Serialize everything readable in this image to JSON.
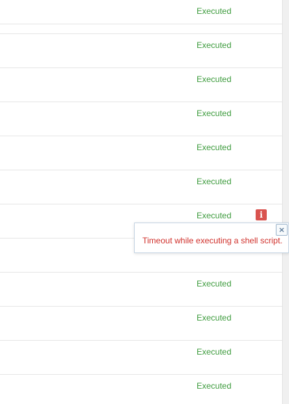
{
  "table": {
    "rows": [
      {
        "status": "Executed",
        "status_color": "#3d9b3d"
      },
      {
        "status": "Executed",
        "status_color": "#3d9b3d"
      },
      {
        "status": "Executed",
        "status_color": "#3d9b3d"
      },
      {
        "status": "Executed",
        "status_color": "#3d9b3d"
      },
      {
        "status": "Executed",
        "status_color": "#3d9b3d"
      },
      {
        "status": "Executed",
        "status_color": "#3d9b3d"
      },
      {
        "status": "Executed",
        "status_color": "#3d9b3d",
        "icon": "info-icon",
        "icon_color": "#d9534f"
      },
      {
        "status": "",
        "status_color": "#3d9b3d"
      },
      {
        "status": "Executed",
        "status_color": "#3d9b3d"
      },
      {
        "status": "Executed",
        "status_color": "#3d9b3d"
      },
      {
        "status": "Executed",
        "status_color": "#3d9b3d"
      },
      {
        "status": "Executed",
        "status_color": "#3d9b3d"
      }
    ],
    "info_icon_glyph": "i"
  },
  "popover": {
    "message": "Timeout while executing a shell script.",
    "message_color": "#d0302b",
    "close_icon": "close-icon",
    "close_glyph": "×"
  }
}
